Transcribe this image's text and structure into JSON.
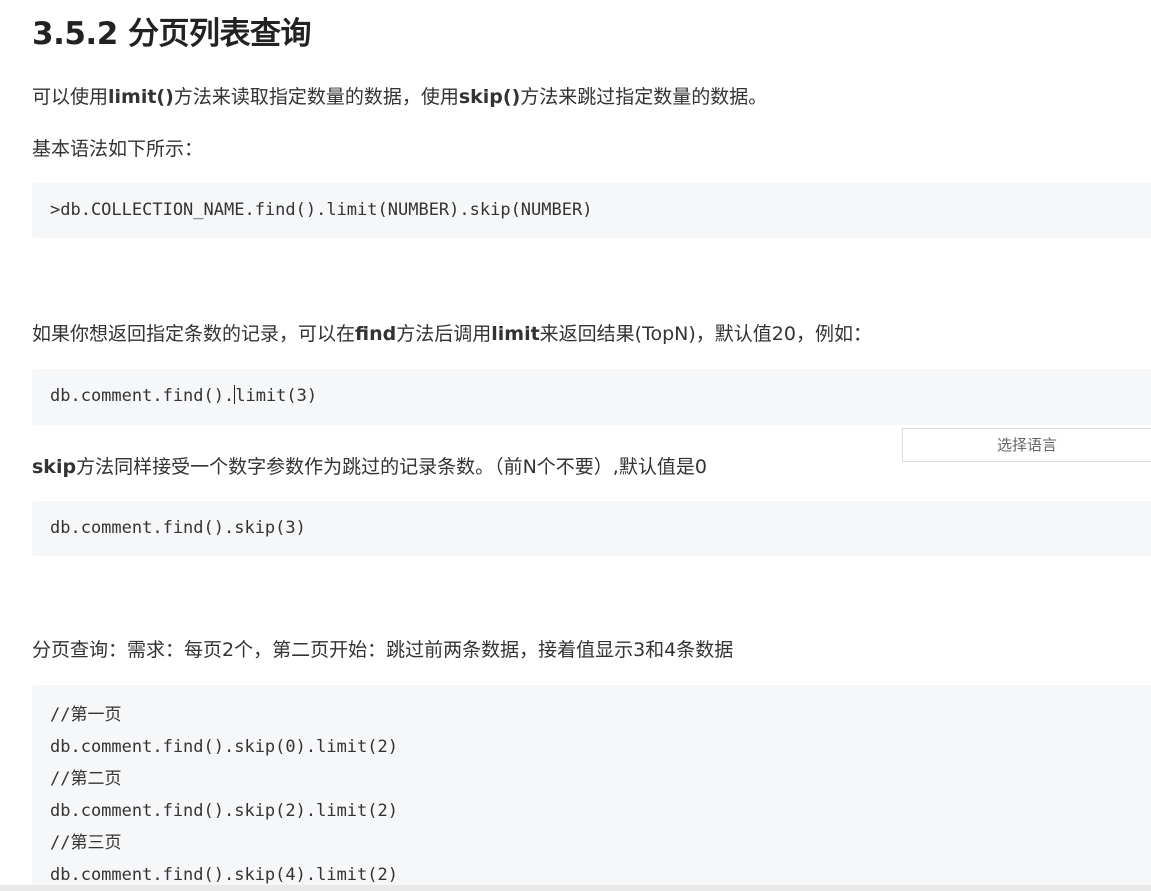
{
  "heading": "3.5.2 分页列表查询",
  "intro": {
    "p1": "可以使用",
    "p1_limit": "limit()",
    "p2": "方法来读取指定数量的数据，使用",
    "p2_skip": "skip()",
    "p3": "方法来跳过指定数量的数据。"
  },
  "syntax_label": "基本语法如下所示：",
  "syntax_code": ">db.COLLECTION_NAME.find().limit(NUMBER).skip(NUMBER)",
  "limit_desc": {
    "p1": "如果你想返回指定条数的记录，可以在",
    "p1_find": "find",
    "p2": "方法后调用",
    "p2_limit": "limit",
    "p3": "来返回结果(TopN)，默认值20，例如："
  },
  "limit_code": {
    "before": "db.comment.find().",
    "after": "limit(3)"
  },
  "language_select": "选择语言",
  "skip_desc": {
    "p1_skip": "skip",
    "p2": "方法同样接受一个数字参数作为跳过的记录条数。（前N个不要）,默认值是0"
  },
  "skip_code": "db.comment.find().skip(3)",
  "paging_desc": "分页查询：需求：每页2个，第二页开始：跳过前两条数据，接着值显示3和4条数据",
  "paging_code": [
    "//第一页",
    "db.comment.find().skip(0).limit(2)",
    "//第二页",
    "db.comment.find().skip(2).limit(2)",
    "//第三页",
    "db.comment.find().skip(4).limit(2)"
  ]
}
